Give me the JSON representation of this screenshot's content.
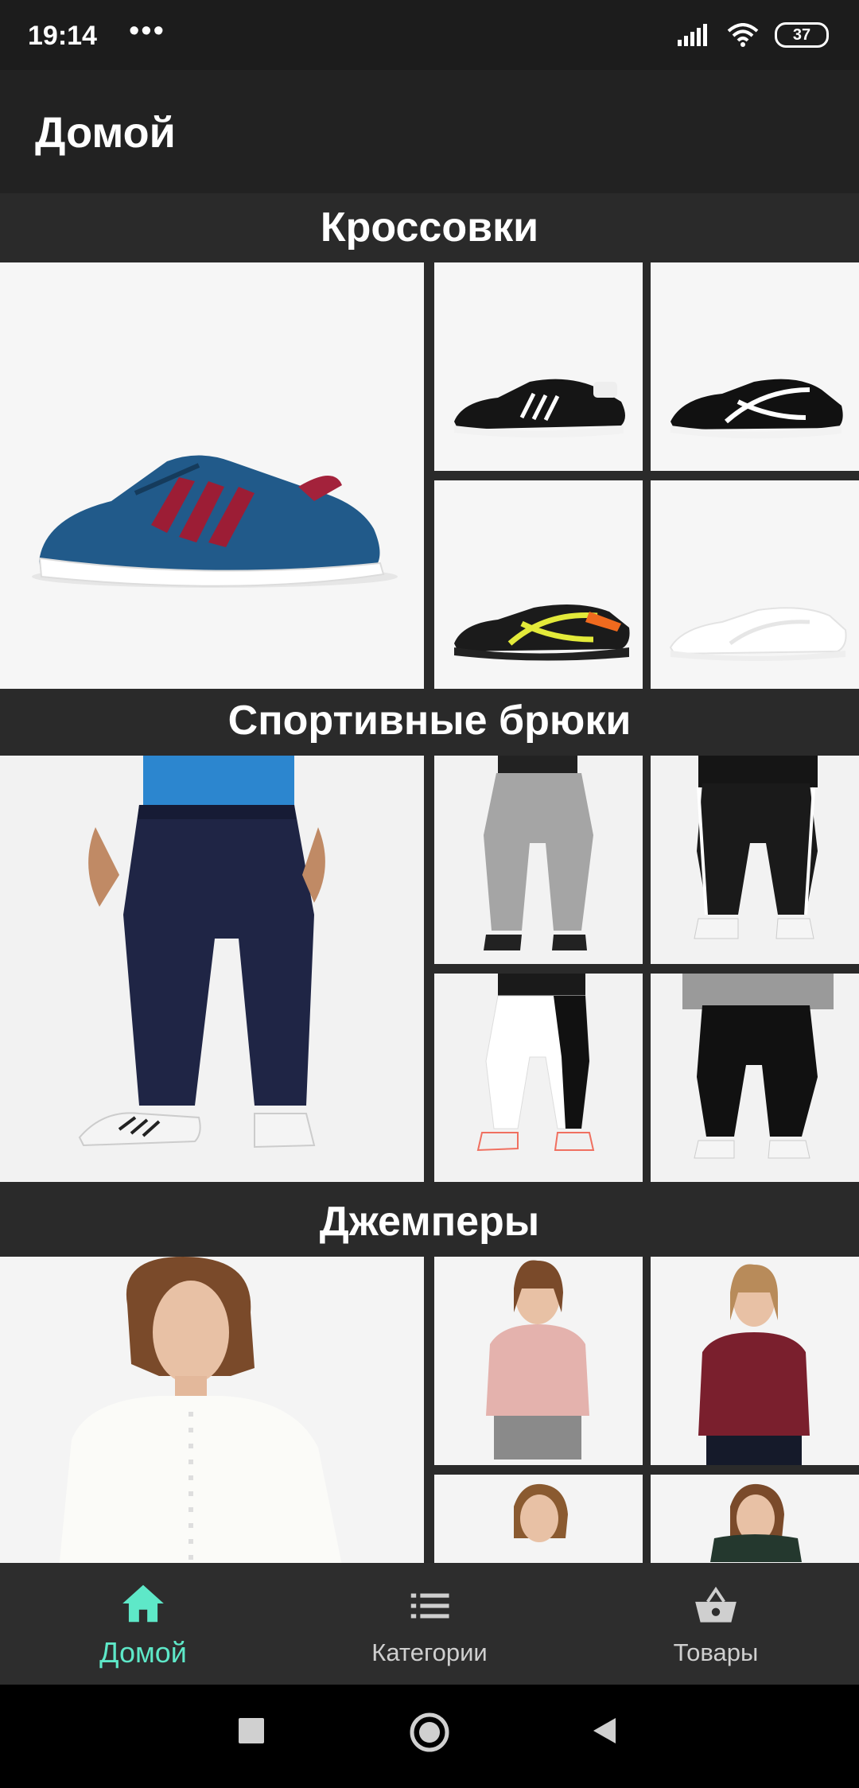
{
  "status_bar": {
    "time": "19:14",
    "more": "•••",
    "battery": "37",
    "icons": [
      "signal-icon",
      "wifi-icon",
      "battery-icon"
    ]
  },
  "app_bar": {
    "title": "Домой"
  },
  "sections": [
    {
      "title": "Кроссовки",
      "images": [
        "sneaker-blue-red-stripes",
        "sneaker-black-white-velcro",
        "sneaker-black-white-stripes",
        "sneaker-black-yellow-orange",
        "sneaker-white"
      ]
    },
    {
      "title": "Спортивные брюки",
      "images": [
        "pants-navy-with-blue-tshirt",
        "pants-grey",
        "pants-black-white-stripes",
        "pants-white-black-side",
        "pants-black-grey-sweatshirt"
      ]
    },
    {
      "title": "Джемперы",
      "images": [
        "jumper-white-knit",
        "jumper-pink",
        "jumper-burgundy",
        "jumper-partial",
        "jumper-partial-2"
      ]
    }
  ],
  "bottom_nav": {
    "items": [
      {
        "label": "Домой",
        "icon": "home-icon",
        "active": true
      },
      {
        "label": "Категории",
        "icon": "list-icon",
        "active": false
      },
      {
        "label": "Товары",
        "icon": "basket-icon",
        "active": false
      }
    ]
  },
  "colors": {
    "accent": "#5ee8c8",
    "app_bar": "#222222",
    "background": "#2a2a2a",
    "nav_inactive": "#cfcfcf"
  }
}
